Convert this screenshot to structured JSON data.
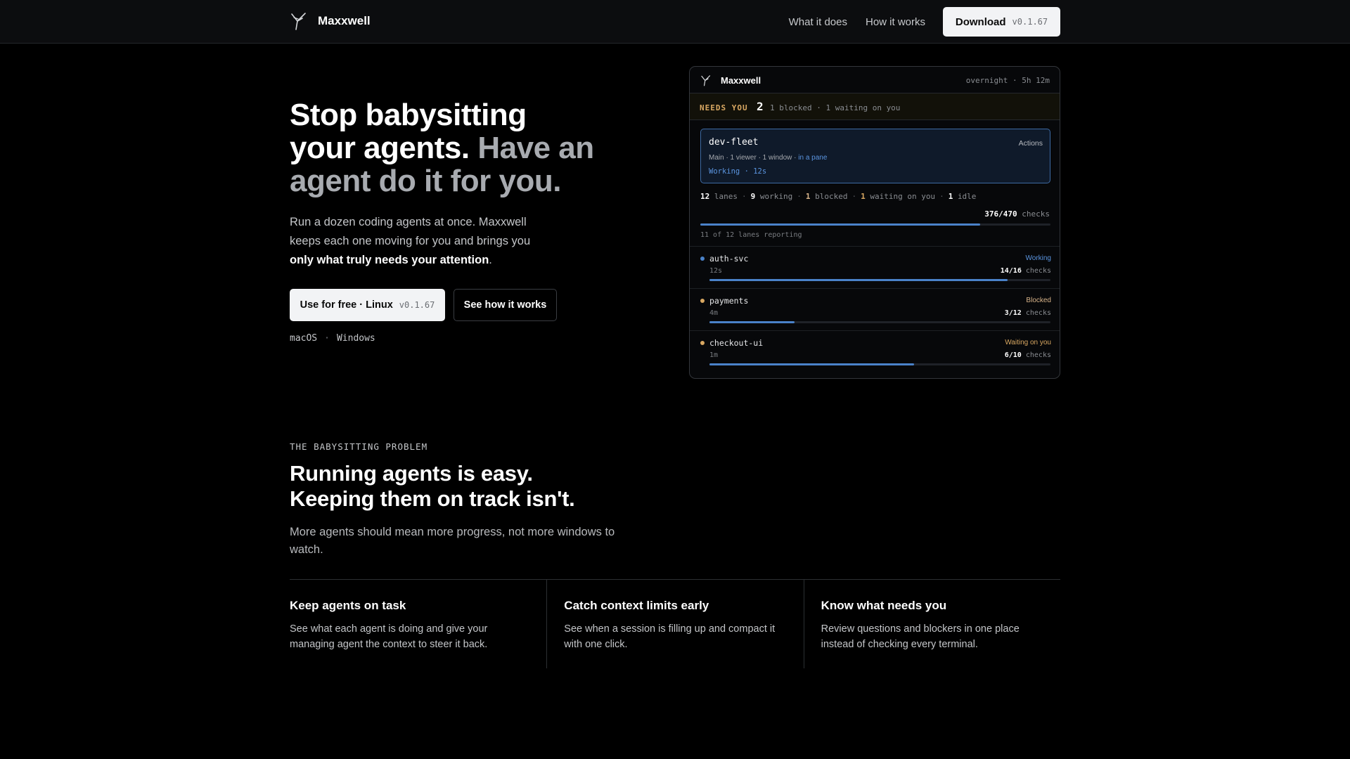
{
  "nav": {
    "brand": "Maxxwell",
    "links": [
      "What it does",
      "How it works"
    ],
    "download_label": "Download",
    "download_version": "v0.1.67"
  },
  "hero": {
    "title_bright": "Stop babysitting your agents.",
    "title_dim": "Have an agent do it for you.",
    "sub_plain": "Run a dozen coding agents at once. Maxxwell keeps each one moving for you and brings you",
    "sub_strong": "only what truly needs your attention",
    "sub_end": ".",
    "primary_label": "Use for free · Linux",
    "primary_version": "v0.1.67",
    "secondary_label": "See how it works",
    "os_mac": "macOS",
    "os_sep": "·",
    "os_win": "Windows"
  },
  "app": {
    "title": "Maxxwell",
    "meta": "overnight · 5h 12m",
    "needs_label": "NEEDS YOU",
    "needs_count": "2",
    "needs_detail": "1 blocked · 1 waiting on you",
    "fleet": {
      "name": "dev-fleet",
      "actions": "Actions",
      "info": "Main · 1 viewer · 1 window ·",
      "info_link": "in a pane",
      "status": "Working · 12s"
    },
    "summary": [
      {
        "n": "12",
        "label": "lanes"
      },
      {
        "n": "9",
        "label": "working"
      },
      {
        "n": "1",
        "label": "blocked"
      },
      {
        "n": "1",
        "label": "waiting on you"
      },
      {
        "n": "1",
        "label": "idle"
      }
    ],
    "totals_value": "376/470",
    "totals_label": "checks",
    "progress": 0.8,
    "reporting": "11 of 12 lanes reporting",
    "lanes": [
      {
        "name": "auth-svc",
        "status": "Working",
        "time": "12s",
        "checks": "14/16",
        "checks_label": "checks",
        "progress": 0.875,
        "color": "#4a82c9"
      },
      {
        "name": "payments",
        "status": "Blocked",
        "time": "4m",
        "checks": "3/12",
        "checks_label": "checks",
        "progress": 0.25,
        "color": "#d9a862"
      },
      {
        "name": "checkout-ui",
        "status": "Waiting on you",
        "time": "1m",
        "checks": "6/10",
        "checks_label": "checks",
        "progress": 0.6,
        "color": "#d9a862"
      }
    ]
  },
  "problem": {
    "eyebrow": "THE BABYSITTING PROBLEM",
    "title_line1": "Running agents is easy.",
    "title_line2": "Keeping them on track isn't.",
    "sub": "More agents should mean more progress, not more windows to watch.",
    "features": [
      {
        "title": "Keep agents on task",
        "body": "See what each agent is doing and give your managing agent the context to steer it back."
      },
      {
        "title": "Catch context limits early",
        "body": "See when a session is filling up and compact it with one click."
      },
      {
        "title": "Know what needs you",
        "body": "Review questions and blockers in one place instead of checking every terminal."
      }
    ]
  },
  "colors": {
    "accent_blue": "#4a82c9",
    "status_blue": "#5b95e0",
    "warn_amber": "#d9a862",
    "blocked_tan": "#d8b48a"
  }
}
